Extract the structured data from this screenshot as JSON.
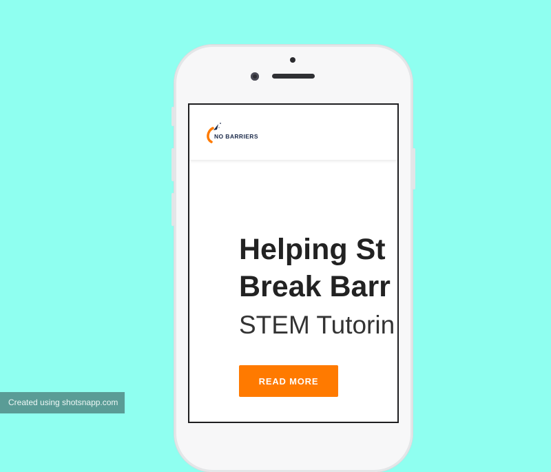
{
  "site": {
    "logo_text": "NO BARRIERS"
  },
  "hero": {
    "title_line1": "Helping St",
    "title_line2": "Break Barr",
    "subtitle": "STEM Tutorin",
    "cta_label": "READ MORE"
  },
  "watermark": {
    "text": "Created using shotsnapp.com"
  },
  "colors": {
    "background": "#8ffff0",
    "accent": "#ff7a00",
    "logo_navy": "#1b2a4a"
  },
  "icons": {
    "logo": "rocket-swoosh-icon"
  }
}
